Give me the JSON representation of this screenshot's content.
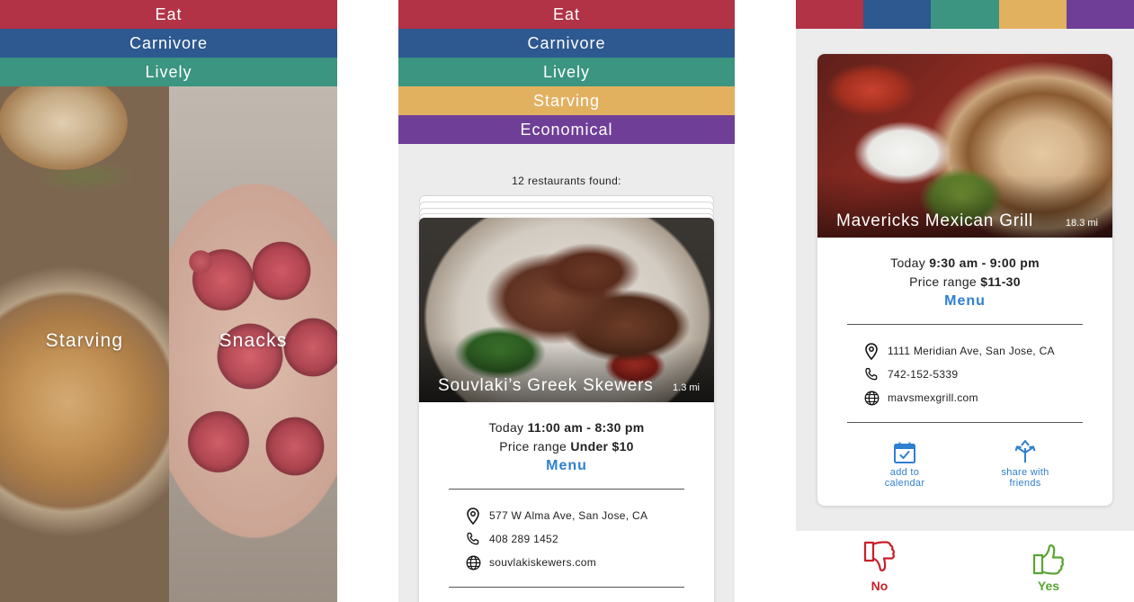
{
  "screen1": {
    "bands": [
      {
        "label": "Eat",
        "color": "#b23346"
      },
      {
        "label": "Carnivore",
        "color": "#2d5890"
      },
      {
        "label": "Lively",
        "color": "#3b9580"
      }
    ],
    "options": [
      "Starving",
      "Snacks"
    ]
  },
  "screen2": {
    "bands": [
      {
        "label": "Eat",
        "color": "#b23346"
      },
      {
        "label": "Carnivore",
        "color": "#2d5890"
      },
      {
        "label": "Lively",
        "color": "#3b9580"
      },
      {
        "label": "Starving",
        "color": "#e2b160"
      },
      {
        "label": "Economical",
        "color": "#6f3f98"
      }
    ],
    "results_text": "12 restaurants found:",
    "card": {
      "name": "Souvlaki’s Greek Skewers",
      "distance": "1.3 mi",
      "hours_prefix": "Today",
      "hours": "11:00 am - 8:30 pm",
      "price_prefix": "Price range",
      "price": "Under $10",
      "menu_label": "Menu",
      "address": "577 W Alma Ave, San Jose, CA",
      "phone": "408 289 1452",
      "website": "souvlakiskewers.com"
    }
  },
  "screen3": {
    "top_colors": [
      "#b23346",
      "#2d5890",
      "#3b9580",
      "#e2b160",
      "#6f3f98"
    ],
    "card": {
      "name": "Mavericks Mexican Grill",
      "distance": "18.3 mi",
      "hours_prefix": "Today",
      "hours": "9:30 am - 9:00 pm",
      "price_prefix": "Price range",
      "price": "$11-30",
      "menu_label": "Menu",
      "address": "1111 Meridian Ave, San Jose, CA",
      "phone": "742-152-5339",
      "website": "mavsmexgrill.com"
    },
    "actions": {
      "calendar_line1": "add to",
      "calendar_line2": "calendar",
      "share_line1": "share with",
      "share_line2": "friends"
    },
    "vote_no": "No",
    "vote_yes": "Yes",
    "accent_color": "#2f7fd1",
    "no_color": "#c8202a",
    "yes_color": "#5aa432"
  }
}
